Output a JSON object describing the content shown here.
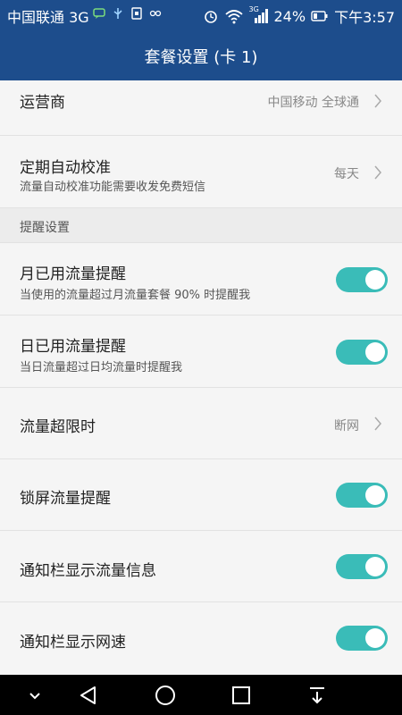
{
  "status_bar": {
    "carrier": "中国联通 3G",
    "network_type": "3G",
    "battery": "24%",
    "time": "下午3:57",
    "icons": [
      "chat-icon",
      "usb-icon",
      "sim-icon",
      "voicemail-icon",
      "alarm-icon",
      "wifi-icon",
      "signal-icon",
      "battery-icon"
    ]
  },
  "header": {
    "title": "套餐设置 (卡 1)"
  },
  "settings": {
    "operator": {
      "label": "运营商",
      "value": "中国移动 全球通"
    },
    "auto_calibrate": {
      "label": "定期自动校准",
      "subtitle": "流量自动校准功能需要收发免费短信",
      "value": "每天"
    },
    "reminder_section": {
      "label": "提醒设置"
    },
    "monthly_reminder": {
      "label": "月已用流量提醒",
      "subtitle": "当使用的流量超过月流量套餐 90% 时提醒我",
      "enabled": true
    },
    "daily_reminder": {
      "label": "日已用流量提醒",
      "subtitle": "当日流量超过日均流量时提醒我",
      "enabled": true
    },
    "over_limit": {
      "label": "流量超限时",
      "value": "断网"
    },
    "lockscreen_reminder": {
      "label": "锁屏流量提醒",
      "enabled": true
    },
    "notification_traffic": {
      "label": "通知栏显示流量信息",
      "enabled": true
    },
    "notification_speed": {
      "label": "通知栏显示网速",
      "enabled": true
    }
  },
  "colors": {
    "header_bg": "#1d4d8c",
    "toggle_on": "#3abcb8",
    "background": "#f5f5f5"
  },
  "nav_bar": {
    "buttons": [
      "dropdown-icon",
      "back-icon",
      "home-icon",
      "recents-icon",
      "notification-pull-icon"
    ]
  }
}
